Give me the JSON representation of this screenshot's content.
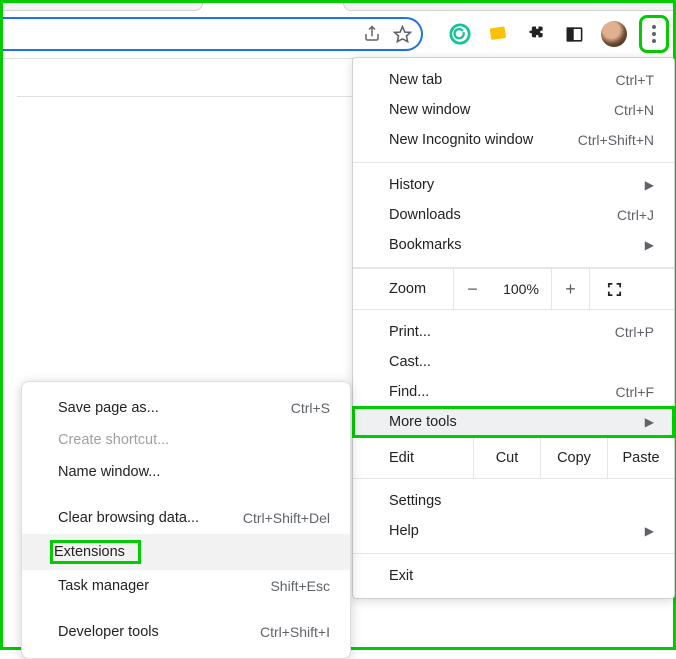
{
  "toolbar": {
    "share_icon": "share-icon",
    "star_icon": "star-icon",
    "extensions": [
      {
        "name": "grammarly-icon",
        "color": "#15c39a"
      },
      {
        "name": "note-icon",
        "color": "#ffc107"
      },
      {
        "name": "puzzle-icon",
        "color": "#222"
      },
      {
        "name": "panel-icon",
        "color": "#222"
      }
    ],
    "avatar": "avatar",
    "kebab": "menu-icon"
  },
  "main_menu": {
    "section1": [
      {
        "label": "New tab",
        "shortcut": "Ctrl+T"
      },
      {
        "label": "New window",
        "shortcut": "Ctrl+N"
      },
      {
        "label": "New Incognito window",
        "shortcut": "Ctrl+Shift+N"
      }
    ],
    "section2": [
      {
        "label": "History",
        "arrow": true
      },
      {
        "label": "Downloads",
        "shortcut": "Ctrl+J"
      },
      {
        "label": "Bookmarks",
        "arrow": true
      }
    ],
    "zoom": {
      "label": "Zoom",
      "minus": "−",
      "value": "100%",
      "plus": "+"
    },
    "section3": [
      {
        "label": "Print...",
        "shortcut": "Ctrl+P"
      },
      {
        "label": "Cast..."
      },
      {
        "label": "Find...",
        "shortcut": "Ctrl+F"
      },
      {
        "label": "More tools",
        "arrow": true,
        "highlight": true
      }
    ],
    "edit": {
      "label": "Edit",
      "cut": "Cut",
      "copy": "Copy",
      "paste": "Paste"
    },
    "section4": [
      {
        "label": "Settings"
      },
      {
        "label": "Help",
        "arrow": true
      }
    ],
    "section5": [
      {
        "label": "Exit"
      }
    ]
  },
  "sub_menu": {
    "items": [
      {
        "label": "Save page as...",
        "shortcut": "Ctrl+S"
      },
      {
        "label": "Create shortcut...",
        "disabled": true
      },
      {
        "label": "Name window..."
      },
      {
        "gap": true
      },
      {
        "label": "Clear browsing data...",
        "shortcut": "Ctrl+Shift+Del"
      },
      {
        "label": "Extensions",
        "highlight": true
      },
      {
        "label": "Task manager",
        "shortcut": "Shift+Esc"
      },
      {
        "gap": true
      },
      {
        "label": "Developer tools",
        "shortcut": "Ctrl+Shift+I"
      }
    ]
  }
}
